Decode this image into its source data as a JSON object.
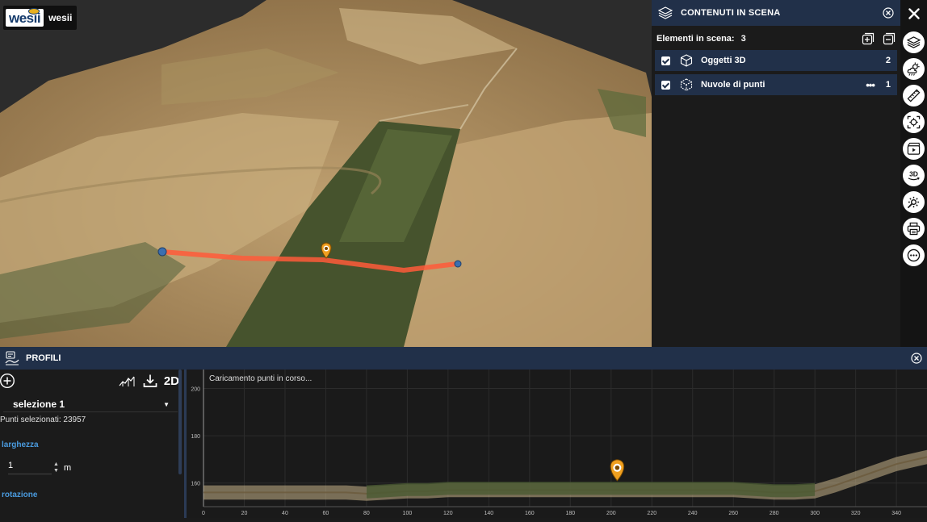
{
  "logo": {
    "mark": "wesii",
    "name": "wesii"
  },
  "scene_panel": {
    "title": "CONTENUTI IN SCENA",
    "count_label": "Elementi in scena:",
    "count_value": "3",
    "layers": [
      {
        "label": "Oggetti 3D",
        "count": "2",
        "icon": "cube-icon",
        "checked": true
      },
      {
        "label": "Nuvole di punti",
        "count": "1",
        "icon": "point-cloud-icon",
        "checked": true,
        "more": "•••"
      }
    ]
  },
  "toolbar": {
    "buttons": [
      "layers-icon",
      "weather-icon",
      "ruler-icon",
      "focus-target-icon",
      "video-icon",
      "3d-icon",
      "tools-icon",
      "print-icon",
      "more-icon"
    ],
    "btn_3d_label": "3D"
  },
  "profiles": {
    "title": "PROFILI",
    "mode_label": "2D",
    "selection": "selezione 1",
    "points_selected": "Punti selezionati: 23957",
    "width_label": "larghezza",
    "width_value": "1",
    "width_unit": "m",
    "rotation_label": "rotazione"
  },
  "chart_data": {
    "type": "area",
    "status_text": "Caricamento punti in corso...",
    "xlim": [
      0,
      355
    ],
    "ylim": [
      150,
      208
    ],
    "x_ticks": [
      0,
      20,
      40,
      60,
      80,
      100,
      120,
      140,
      160,
      180,
      200,
      220,
      240,
      260,
      280,
      300,
      320,
      340
    ],
    "y_ticks": [
      160,
      180,
      200
    ],
    "profile_x": [
      0,
      20,
      40,
      60,
      70,
      80,
      90,
      100,
      110,
      120,
      130,
      140,
      150,
      160,
      170,
      180,
      190,
      200,
      210,
      220,
      230,
      240,
      250,
      260,
      270,
      280,
      290,
      300,
      310,
      320,
      330,
      340,
      355
    ],
    "profile_y": [
      156,
      156,
      156,
      156,
      156,
      155.5,
      156,
      156.5,
      156.5,
      157,
      157,
      157,
      157,
      157,
      157,
      157,
      157,
      157,
      157,
      157,
      157,
      157,
      157,
      157,
      156.5,
      156,
      156,
      156.5,
      159,
      162,
      165,
      168,
      171
    ],
    "marker_x": 203,
    "grid": true,
    "colors": {
      "terrain_top": "#c9b48a",
      "vegetation": "#4a5a32",
      "marker": "#f0a020",
      "grid": "#2c2c2c",
      "axis_text": "#bdbdbd"
    }
  }
}
